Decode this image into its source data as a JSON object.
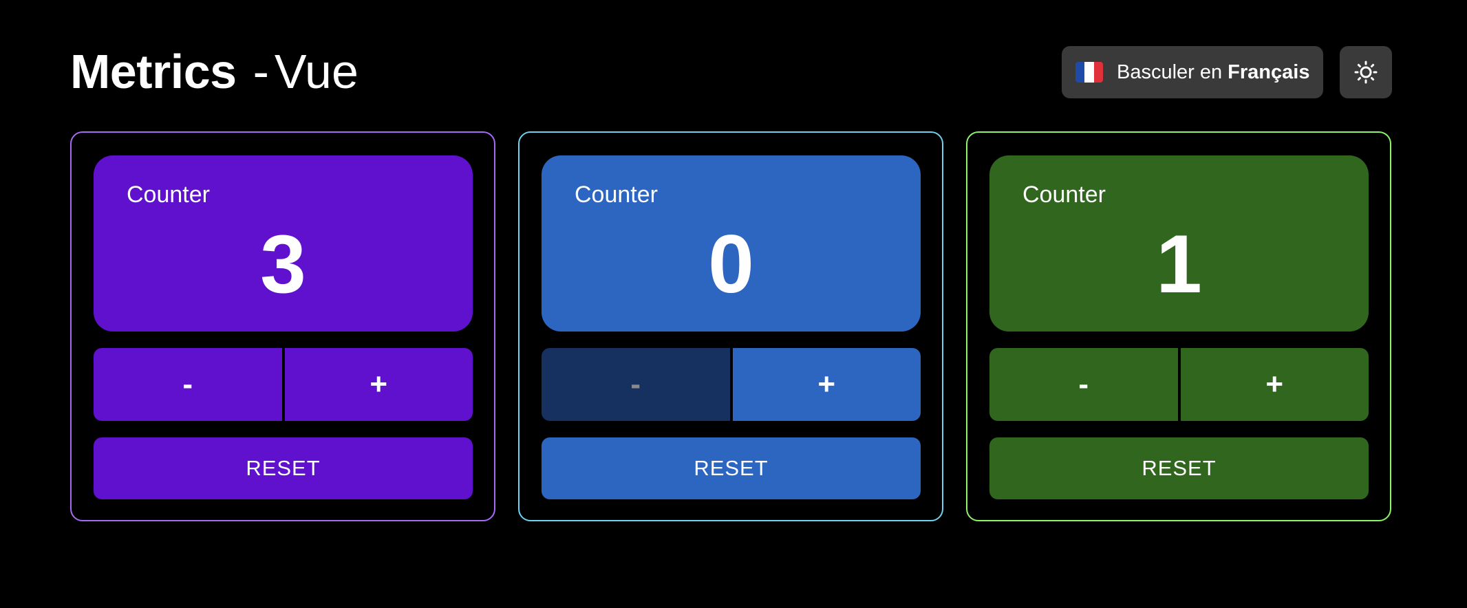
{
  "header": {
    "app_name": "Metrics",
    "separator": "-",
    "framework": "Vue",
    "language_button": {
      "prefix": "Basculer en",
      "language": "Français",
      "flag_icon": "france-flag-icon",
      "flag_colors": [
        "#1f4aa8",
        "#ffffff",
        "#e0313a"
      ]
    },
    "theme_button": {
      "icon": "sun-icon"
    }
  },
  "counters": [
    {
      "label": "Counter",
      "value": "3",
      "minus_label": "-",
      "plus_label": "+",
      "reset_label": "RESET",
      "minus_disabled": false,
      "colors": {
        "border": "#a86bf5",
        "fill": "#5f11cd",
        "disabled_fill": "#5f11cd"
      }
    },
    {
      "label": "Counter",
      "value": "0",
      "minus_label": "-",
      "plus_label": "+",
      "reset_label": "RESET",
      "minus_disabled": true,
      "colors": {
        "border": "#6fd3ee",
        "fill": "#2c66c0",
        "disabled_fill": "#163160"
      }
    },
    {
      "label": "Counter",
      "value": "1",
      "minus_label": "-",
      "plus_label": "+",
      "reset_label": "RESET",
      "minus_disabled": false,
      "colors": {
        "border": "#8cf56a",
        "fill": "#31661f",
        "disabled_fill": "#31661f"
      }
    }
  ]
}
